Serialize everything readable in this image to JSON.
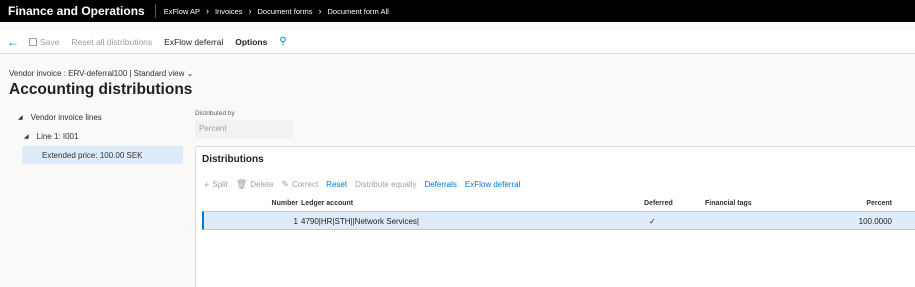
{
  "topbar": {
    "app_title": "Finance and Operations",
    "breadcrumbs": [
      "ExFlow AP",
      "Invoices",
      "Document forms",
      "Document form All"
    ]
  },
  "actionbar": {
    "save": "Save",
    "reset_all": "Reset all distributions",
    "exflow_deferral": "ExFlow deferral",
    "options": "Options"
  },
  "header": {
    "context": "Vendor invoice : ERV-deferral100  |  Standard view",
    "title": "Accounting distributions"
  },
  "tree": {
    "root": "Vendor invoice lines",
    "line": "Line 1: I001",
    "selected": "Extended price: 100.00 SEK"
  },
  "distributed_by": {
    "label": "Distributed by",
    "value": "Percent"
  },
  "distributions": {
    "title": "Distributions",
    "toolbar": {
      "split": "Split",
      "delete": "Delete",
      "correct": "Correct",
      "reset": "Reset",
      "distribute_equally": "Distribute equally",
      "deferrals": "Deferrals",
      "exflow_deferral": "ExFlow deferral"
    },
    "columns": {
      "number": "Number",
      "ledger_account": "Ledger account",
      "deferred": "Deferred",
      "financial_tags": "Financial tags",
      "percent": "Percent"
    },
    "rows": [
      {
        "number": "1",
        "ledger_account": "4790|HR|STH||Network Services|",
        "deferred": "✓",
        "financial_tags": "",
        "percent": "100.0000"
      }
    ]
  }
}
